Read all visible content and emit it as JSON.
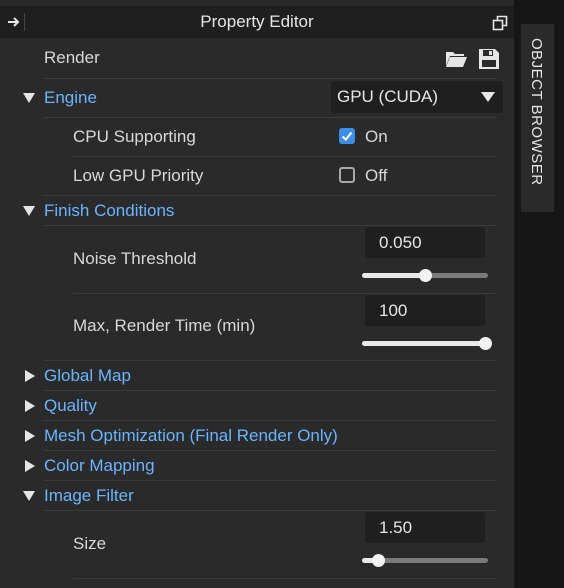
{
  "panel": {
    "title": "Property Editor"
  },
  "render": {
    "label": "Render"
  },
  "engine": {
    "label": "Engine",
    "dropdown_value": "GPU (CUDA)",
    "cpu_supporting": {
      "label": "CPU Supporting",
      "checked": true,
      "value_label": "On"
    },
    "low_gpu_priority": {
      "label": "Low GPU Priority",
      "checked": false,
      "value_label": "Off"
    }
  },
  "finish_conditions": {
    "label": "Finish Conditions",
    "noise_threshold": {
      "label": "Noise Threshold",
      "value": "0.050",
      "slider_fraction": 0.5
    },
    "max_render_time": {
      "label": "Max, Render Time (min)",
      "value": "100",
      "slider_fraction": 1.0
    }
  },
  "collapsed_sections": [
    {
      "label": "Global Map"
    },
    {
      "label": "Quality"
    },
    {
      "label": "Mesh Optimization (Final Render Only)"
    },
    {
      "label": "Color Mapping"
    }
  ],
  "image_filter": {
    "label": "Image Filter",
    "size": {
      "label": "Size",
      "value": "1.50",
      "slider_fraction": 0.11
    }
  },
  "side_tab": {
    "label": "OBJECT BROWSER"
  },
  "colors": {
    "accent": "#6ab4ff",
    "checkbox_on": "#3d8ee6",
    "panel_bg": "#2a2a2a"
  }
}
